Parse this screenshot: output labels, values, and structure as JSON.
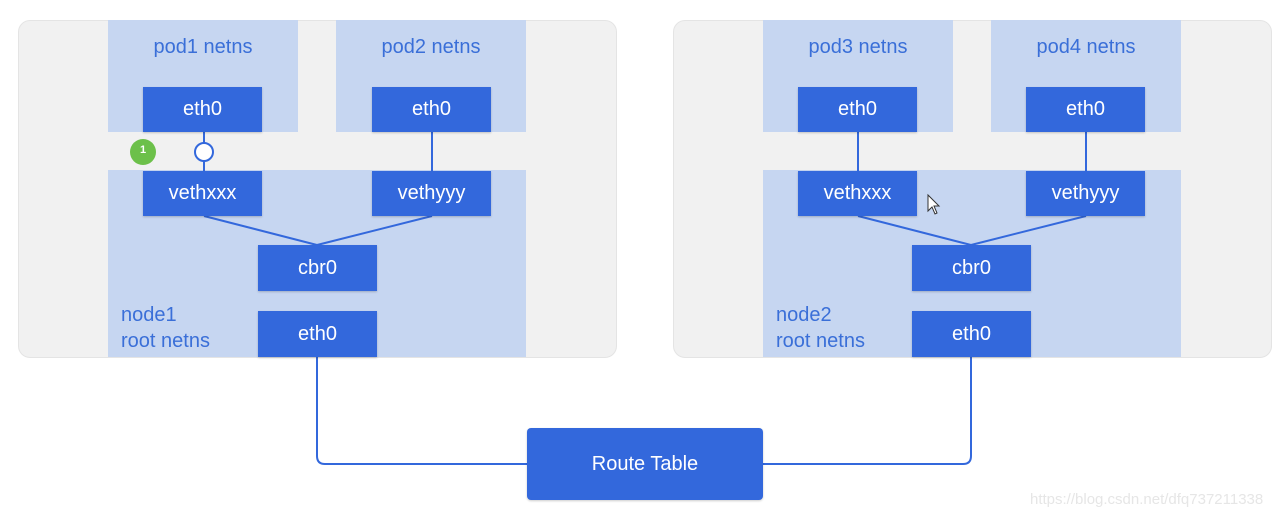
{
  "nodes": [
    {
      "name": "node1",
      "root_label": [
        "node1",
        "root netns"
      ],
      "pods": [
        "pod1 netns",
        "pod2 netns"
      ],
      "pod_eth": [
        "eth0",
        "eth0"
      ],
      "veths": [
        "vethxxx",
        "vethyyy"
      ],
      "bridge": "cbr0",
      "node_eth": "eth0"
    },
    {
      "name": "node2",
      "root_label": [
        "node2",
        "root netns"
      ],
      "pods": [
        "pod3 netns",
        "pod4 netns"
      ],
      "pod_eth": [
        "eth0",
        "eth0"
      ],
      "veths": [
        "vethxxx",
        "vethyyy"
      ],
      "bridge": "cbr0",
      "node_eth": "eth0"
    }
  ],
  "step_badge": "1",
  "route_table": "Route Table",
  "watermark": "https://blog.csdn.net/dfq737211338",
  "colors": {
    "box": "#3368dc",
    "netns": "#c6d6f1",
    "panel": "#f1f1f1",
    "badge": "#6cc04a",
    "line": "#3368dc"
  }
}
